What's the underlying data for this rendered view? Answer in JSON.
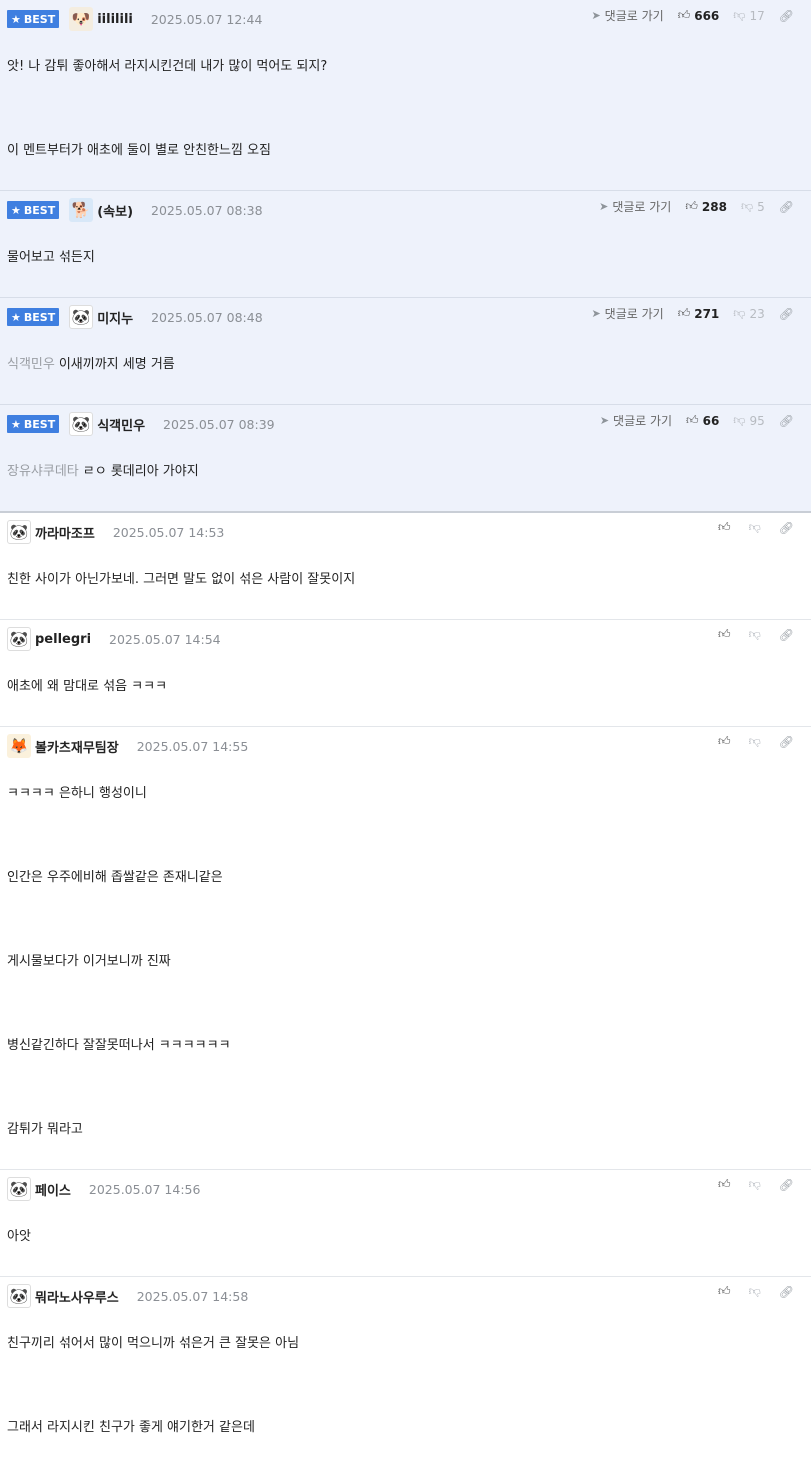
{
  "best_label": "BEST",
  "goto_label": "댓글로 가기",
  "best_comments": [
    {
      "nick": "iililili",
      "date": "2025.05.07 12:44",
      "likes": "666",
      "dislikes": "17",
      "avatar": "dog-icon",
      "lines": [
        "앗! 나 감튀 좋아해서 라지시킨건데 내가 많이 먹어도 되지?",
        "",
        "이 멘트부터가 애초에 둘이 별로 안친한느낌 오짐"
      ]
    },
    {
      "nick": "(속보)",
      "date": "2025.05.07 08:38",
      "likes": "288",
      "dislikes": "5",
      "avatar": "blue-dog-icon",
      "lines": [
        "물어보고 섞든지"
      ]
    },
    {
      "nick": "미지누",
      "date": "2025.05.07 08:48",
      "likes": "271",
      "dislikes": "23",
      "avatar": "panda-icon",
      "mention": "식객민우",
      "lines": [
        "이새끼까지 세명 거름"
      ]
    },
    {
      "nick": "식객민우",
      "date": "2025.05.07 08:39",
      "likes": "66",
      "dislikes": "95",
      "avatar": "panda-icon",
      "mention": "장유샤쿠데타",
      "lines": [
        "ㄹㅇ 롯데리아 가야지"
      ]
    }
  ],
  "comments": [
    {
      "nick": "까라마조프",
      "date": "2025.05.07 14:53",
      "avatar": "panda-icon",
      "lines": [
        "친한 사이가 아닌가보네. 그러면 말도 없이 섞은 사람이 잘못이지"
      ]
    },
    {
      "nick": "pellegri",
      "date": "2025.05.07 14:54",
      "avatar": "panda-icon",
      "lines": [
        "애초에 왜 맘대로 섞음 ㅋㅋㅋ"
      ]
    },
    {
      "nick": "볼카츠재무팀장",
      "date": "2025.05.07 14:55",
      "avatar": "fox-icon",
      "lines": [
        "ㅋㅋㅋㅋ 은하니 행성이니",
        "",
        "인간은 우주에비해 좁쌀같은 존재니같은",
        "",
        "게시물보다가 이거보니까 진짜",
        "",
        "병신같긴하다 잘잘못떠나서 ㅋㅋㅋㅋㅋㅋ",
        "",
        "감튀가 뭐라고"
      ]
    },
    {
      "nick": "페이스",
      "date": "2025.05.07 14:56",
      "avatar": "panda-icon",
      "lines": [
        "아앗"
      ]
    },
    {
      "nick": "뭐라노사우루스",
      "date": "2025.05.07 14:58",
      "avatar": "panda-icon",
      "lines": [
        "친구끼리 섞어서 많이 먹으니까 섞은거 큰 잘못은 아님",
        "",
        "그래서 라지시킨 친구가 좋게 얘기한거 같은데"
      ]
    }
  ]
}
